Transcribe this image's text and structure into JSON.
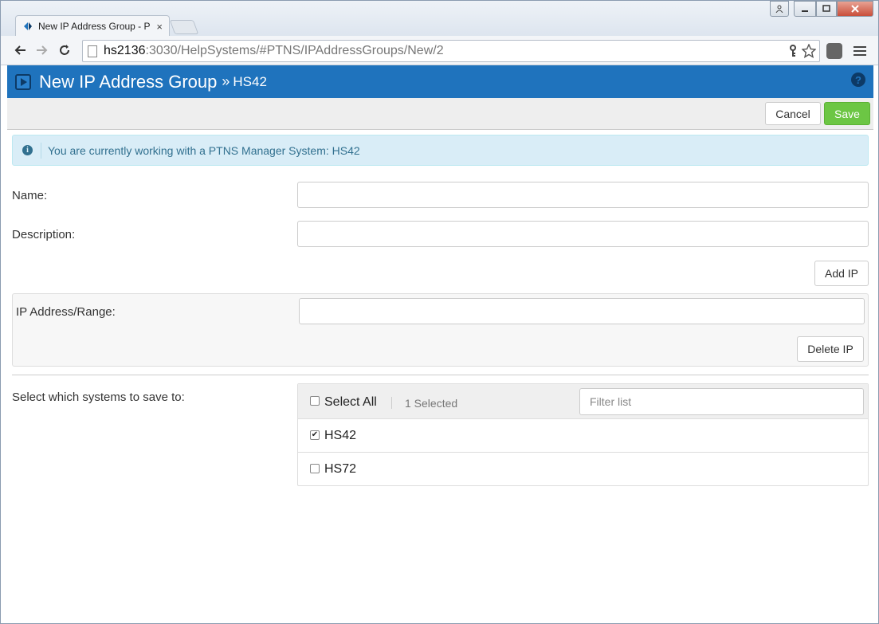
{
  "browser": {
    "tab_title": "New IP Address Group - P",
    "tab_close": "×",
    "url_host": "hs2136",
    "url_rest": ":3030/HelpSystems/#PTNS/IPAddressGroups/New/2"
  },
  "header": {
    "title": "New IP Address Group",
    "separator": "»",
    "subtitle": "HS42",
    "help": "?"
  },
  "actions": {
    "cancel_label": "Cancel",
    "save_label": "Save"
  },
  "alert": {
    "text": "You are currently working with a PTNS Manager System: HS42"
  },
  "form": {
    "name_label": "Name:",
    "name_value": "",
    "description_label": "Description:",
    "description_value": "",
    "add_ip_label": "Add IP",
    "ip_label": "IP Address/Range:",
    "ip_value": "",
    "delete_ip_label": "Delete IP",
    "systems_label": "Select which systems to save to:"
  },
  "systems": {
    "select_all_label": "Select All",
    "select_all_checked": false,
    "selected_count": "1 Selected",
    "filter_placeholder": "Filter list",
    "items": [
      {
        "label": "HS42",
        "checked": true
      },
      {
        "label": "HS72",
        "checked": false
      }
    ]
  },
  "colors": {
    "header_bg": "#1f73bd",
    "save_bg": "#6cc644",
    "alert_bg": "#d9edf7",
    "alert_text": "#31708f"
  }
}
